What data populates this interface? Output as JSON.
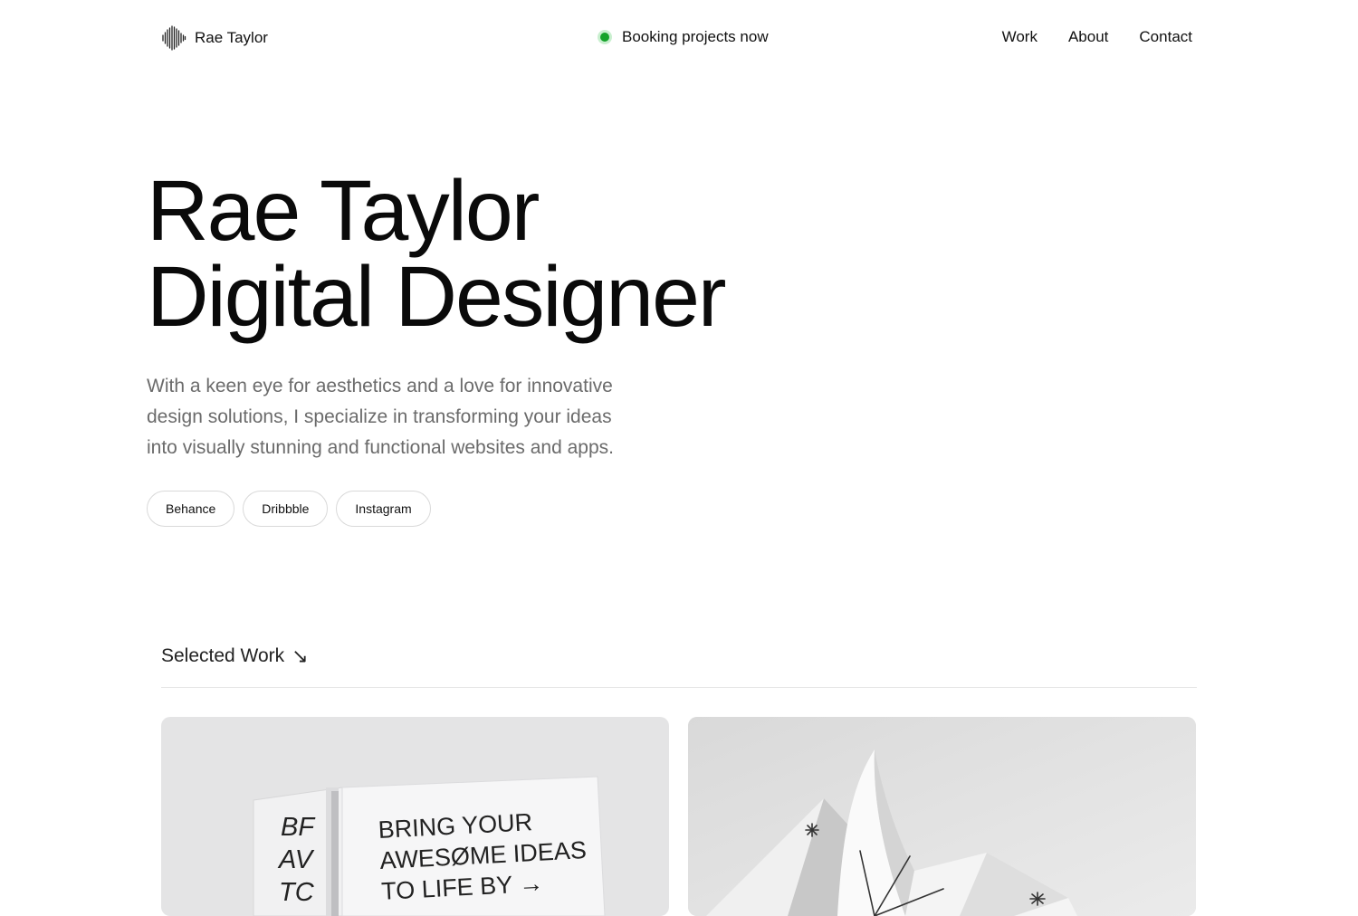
{
  "brand": {
    "name": "Rae Taylor",
    "logo_icon": "sound-wave-icon"
  },
  "status": {
    "text": "Booking projects now",
    "dot_color": "#16a32b"
  },
  "nav": {
    "items": [
      "Work",
      "About",
      "Contact"
    ]
  },
  "hero": {
    "title_line1": "Rae Taylor",
    "title_line2": "Digital Designer",
    "description": "With a keen eye for aesthetics and a love for innovative design solutions, I specialize in transforming your ideas into visually stunning and functional websites and apps."
  },
  "socials": [
    "Behance",
    "Dribbble",
    "Instagram"
  ],
  "work": {
    "title": "Selected Work",
    "arrow": "↘",
    "projects": [
      {
        "image_text": [
          "BRING YOUR",
          "AWESØME IDEAS",
          "TO LIFE BY →"
        ],
        "spine_text": [
          "BF",
          "AV",
          "TC"
        ]
      },
      {
        "image_icon": "paper-sculpture-icon"
      }
    ]
  }
}
